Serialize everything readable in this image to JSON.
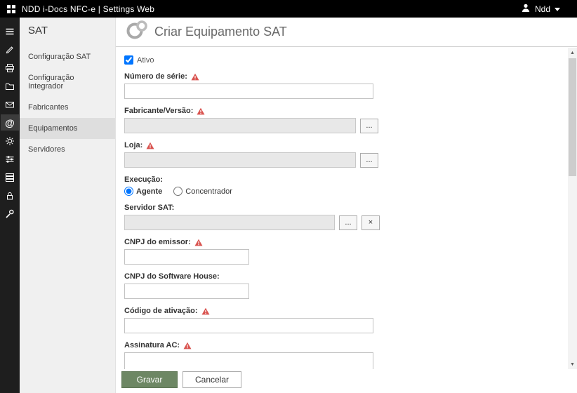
{
  "topbar": {
    "title": "NDD i-Docs NFC-e | Settings Web",
    "user_name": "Ndd"
  },
  "icons": {
    "app": "grid-waffle",
    "user": "person-silhouette",
    "rail": [
      "menu",
      "pen",
      "printer",
      "folder",
      "mail",
      "at",
      "gear",
      "workflow",
      "server",
      "lock",
      "wrench"
    ],
    "required": "warning-triangle",
    "page": "double-ring"
  },
  "nav": {
    "title": "SAT",
    "items": [
      {
        "label": "Configuração SAT"
      },
      {
        "label": "Configuração Integrador"
      },
      {
        "label": "Fabricantes"
      },
      {
        "label": "Equipamentos"
      },
      {
        "label": "Servidores"
      }
    ]
  },
  "header": {
    "title": "Criar Equipamento SAT"
  },
  "form": {
    "active_label": "Ativo",
    "active_checked": true,
    "serial_label": "Número de série:",
    "serial_value": "",
    "manufacturer_label": "Fabricante/Versão:",
    "manufacturer_value": "",
    "store_label": "Loja:",
    "store_value": "",
    "execution_label": "Execução:",
    "execution_agent": "Agente",
    "execution_concentrator": "Concentrador",
    "execution_selected": "Agente",
    "server_label": "Servidor SAT:",
    "server_value": "",
    "cnpj_issuer_label": "CNPJ do emissor:",
    "cnpj_issuer_value": "",
    "cnpj_software_label": "CNPJ do Software House:",
    "cnpj_software_value": "",
    "activation_label": "Código de ativação:",
    "activation_value": "",
    "signature_label": "Assinatura AC:",
    "signature_value": "",
    "browse_label": "...",
    "clear_label": "×"
  },
  "footer": {
    "save_label": "Gravar",
    "cancel_label": "Cancelar"
  },
  "scrollbar": {
    "up_arrow": "▲",
    "down_arrow": "▼"
  },
  "colors": {
    "accent_green": "#6d8764",
    "required_red": "#d9534f",
    "topbar": "#000000"
  }
}
